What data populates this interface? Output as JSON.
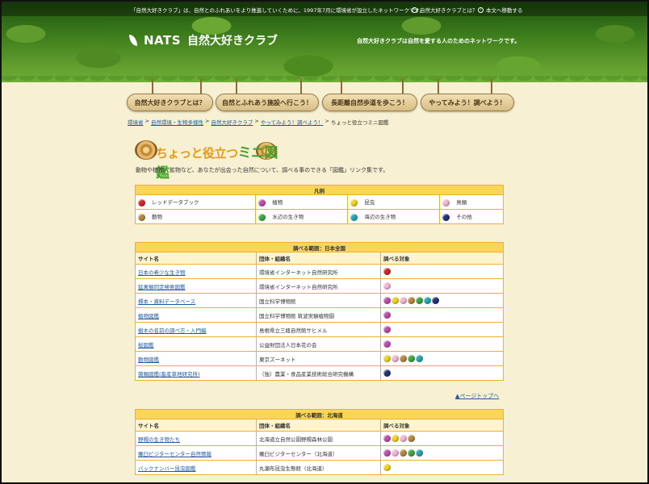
{
  "header": {
    "top_text": "「自然大好きクラブ」は、自然とのふれあいをより推進していくために、1997年7月に環境省が設立したネットワークです。",
    "top_links": [
      "自然大好きクラブとは？",
      "本文へ移動する"
    ],
    "logo_name": "NATS",
    "site_title": "自然大好きクラブ",
    "tagline": "自然大好きクラブは自然を愛する人のためのネットワークです。"
  },
  "nav": [
    "自然大好きクラブとは？",
    "自然とふれあう施設へ行こう！",
    "長距離自然歩道を歩こう！",
    "やってみよう！調べよう！"
  ],
  "breadcrumb": {
    "links": [
      "環境省",
      "自然環境・生物多様性",
      "自然大好きクラブ",
      "やってみよう！調べよう！"
    ],
    "separator": ">",
    "current": "ちょっと役立つミニ図鑑"
  },
  "title": {
    "small": "ちょっと役立つ",
    "big": "ミニ図鑑"
  },
  "intro": "動物や植物、鉱物など、あなたが出会った自然について、調べる事のできる「図鑑」リンク集です。",
  "legend": {
    "caption": "凡例",
    "items": [
      {
        "label": "レッドデータブック",
        "color": "#d9252a"
      },
      {
        "label": "植物",
        "color": "#c24fb0"
      },
      {
        "label": "昆虫",
        "color": "#f2d41e"
      },
      {
        "label": "鳥類",
        "color": "#f5b7d8"
      },
      {
        "label": "動物",
        "color": "#b88a3e"
      },
      {
        "label": "水辺の生き物",
        "color": "#41a844"
      },
      {
        "label": "海辺の生き物",
        "color": "#27a9b5"
      },
      {
        "label": "その他",
        "color": "#24347c"
      }
    ]
  },
  "table1": {
    "caption": "調べる範囲：日本全国",
    "headers": [
      "サイト名",
      "団体・組織名",
      "調べる対象"
    ],
    "rows": [
      {
        "site": "日本の希少な生き物",
        "org": "環境省インターネット自然研究所",
        "dots": [
          "#d9252a"
        ]
      },
      {
        "site": "猛禽類同定検索図鑑",
        "org": "環境省インターネット自然研究所",
        "dots": [
          "#f5b7d8"
        ]
      },
      {
        "site": "標本・資料データベース",
        "org": "国立科学博物館",
        "dots": [
          "#c24fb0",
          "#f2d41e",
          "#f5b7d8",
          "#b88a3e",
          "#41a844",
          "#27a9b5",
          "#24347c"
        ]
      },
      {
        "site": "植物図鑑",
        "org": "国立科学博物館 筑波実験植物園",
        "dots": [
          "#c24fb0"
        ]
      },
      {
        "site": "樹木の名前の調べ方・入門編",
        "org": "島根県立三瓶自然館サヒメル",
        "dots": [
          "#c24fb0"
        ]
      },
      {
        "site": "桜図鑑",
        "org": "公益財団法人日本花の会",
        "dots": [
          "#c24fb0"
        ]
      },
      {
        "site": "動物図鑑",
        "org": "東京ズーネット",
        "dots": [
          "#f2d41e",
          "#f5b7d8",
          "#b88a3e",
          "#41a844",
          "#27a9b5"
        ]
      },
      {
        "site": "菌類図鑑(畜産草地研究所)",
        "org": "（独）農業・食品産業技術総合研究機構",
        "dots": [
          "#24347c"
        ]
      }
    ]
  },
  "pagetop": "▲ページトップへ",
  "table2": {
    "caption": "調べる範囲：北海道",
    "headers": [
      "サイト名",
      "団体・組織名",
      "調べる対象"
    ],
    "rows": [
      {
        "site": "野幌の生き物たち",
        "org": "北海道立自然公園野幌森林公園",
        "dots": [
          "#c24fb0",
          "#f2d41e",
          "#f5b7d8",
          "#b88a3e"
        ]
      },
      {
        "site": "羅臼ビジターセンター自然情報",
        "org": "羅臼ビジターセンター（北海道）",
        "dots": [
          "#c24fb0",
          "#f5b7d8",
          "#b88a3e",
          "#41a844",
          "#27a9b5"
        ]
      },
      {
        "site": "バックナンバー昆虫図鑑",
        "org": "丸瀬布昆虫生態館（北海道）",
        "dots": [
          "#f2d41e"
        ]
      }
    ]
  }
}
